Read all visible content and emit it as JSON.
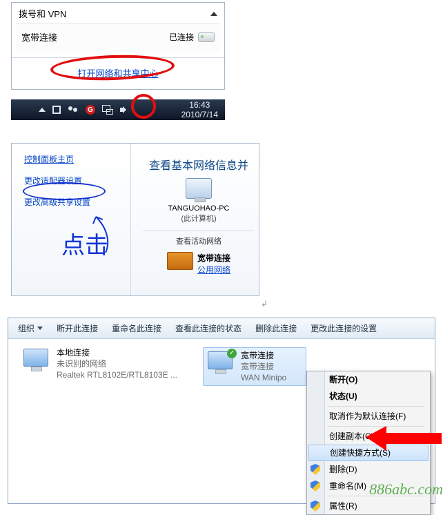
{
  "popup": {
    "section_title": "拨号和 VPN",
    "conn_name": "宽带连接",
    "conn_status": "已连接",
    "footer_link": "打开网络和共享中心"
  },
  "taskbar": {
    "time": "16:43",
    "date": "2010/7/14"
  },
  "cp": {
    "home_link": "控制面板主页",
    "adapter_settings": "更改适配器设置",
    "advanced_sharing": "更改高级共享设置",
    "right_title": "查看基本网络信息并",
    "pc_name": "TANGUOHAO-PC",
    "pc_sub": "(此计算机)",
    "active_net": "查看活动网络",
    "conn2_name": "宽带连接",
    "conn2_type": "公用网络",
    "handwriting": "点击"
  },
  "tb": {
    "org": "组织",
    "disconnect": "断开此连接",
    "rename": "重命名此连接",
    "status": "查看此连接的状态",
    "delete": "删除此连接",
    "settings": "更改此连接的设置"
  },
  "conns": {
    "lan_name": "本地连接",
    "lan_sub1": "未识别的网络",
    "lan_sub2": "Realtek RTL8102E/RTL8103E ...",
    "bb_name": "宽带连接",
    "bb_sub1": "宽带连接",
    "bb_sub2": "WAN Minipo"
  },
  "menu": {
    "disconnect": "断开(O)",
    "status": "状态(U)",
    "unset_default": "取消作为默认连接(F)",
    "copy": "创建副本(C)",
    "shortcut": "创建快捷方式(S)",
    "delete": "删除(D)",
    "rename": "重命名(M)",
    "properties": "属性(R)"
  },
  "watermark": "886abc.com"
}
